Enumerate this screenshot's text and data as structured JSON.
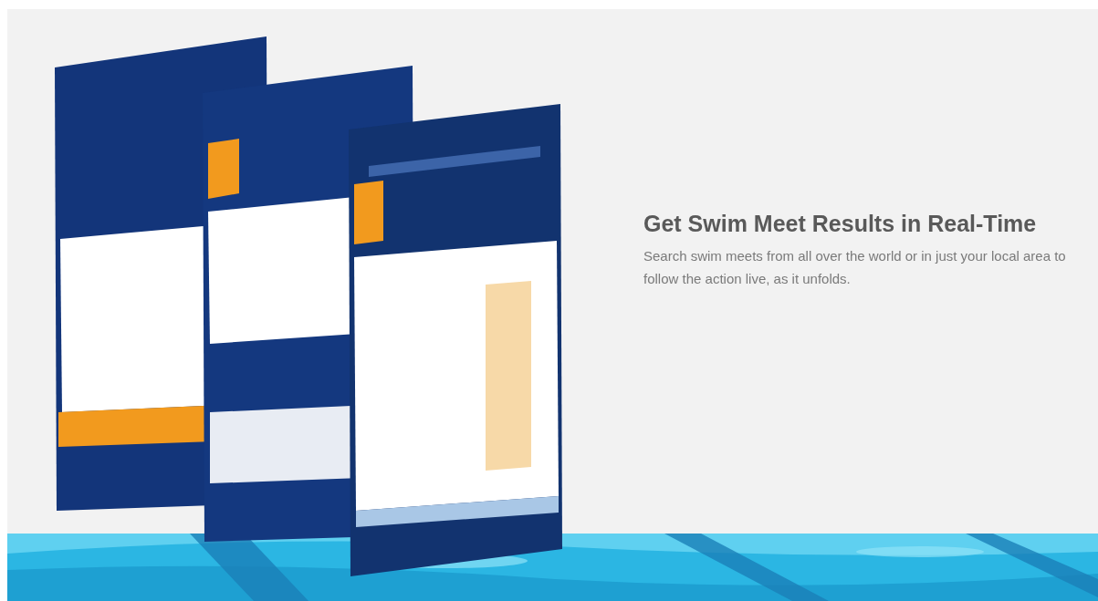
{
  "hero": {
    "heading": "Get Swim Meet Results in Real-Time",
    "text": "Search swim meets from all over the world or in just your local area to follow the action live, as it unfolds."
  }
}
